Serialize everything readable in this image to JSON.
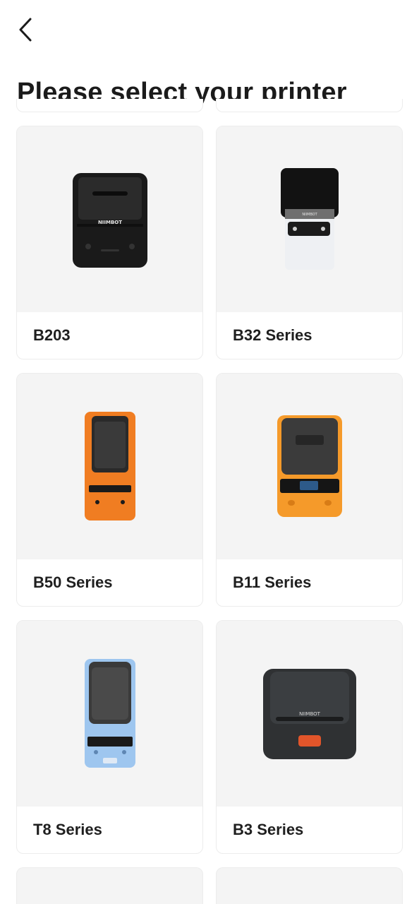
{
  "header": {
    "back_icon": "chevron-left-icon",
    "title": "Please select your printer"
  },
  "printers": [
    {
      "name": "B203",
      "image": "printer-b203-black",
      "colors": {
        "body": "#1c1c1c",
        "accent": "#2a2a2a"
      }
    },
    {
      "name": "B32 Series",
      "image": "printer-b32-black-white",
      "colors": {
        "top": "#141414",
        "bottom": "#eceff2"
      }
    },
    {
      "name": "B50 Series",
      "image": "printer-b50-orange",
      "colors": {
        "body": "#f07d22",
        "lid": "#2a2a2a"
      }
    },
    {
      "name": "B11 Series",
      "image": "printer-b11-orange",
      "colors": {
        "body": "#f59a2a",
        "lid": "#3b3b3b"
      }
    },
    {
      "name": "T8 Series",
      "image": "printer-t8-blue",
      "colors": {
        "body": "#9ec6ef",
        "lid": "#3a3a3a"
      }
    },
    {
      "name": "B3 Series",
      "image": "printer-b3-dark",
      "colors": {
        "body": "#2f3133",
        "button": "#e2552a"
      }
    }
  ]
}
